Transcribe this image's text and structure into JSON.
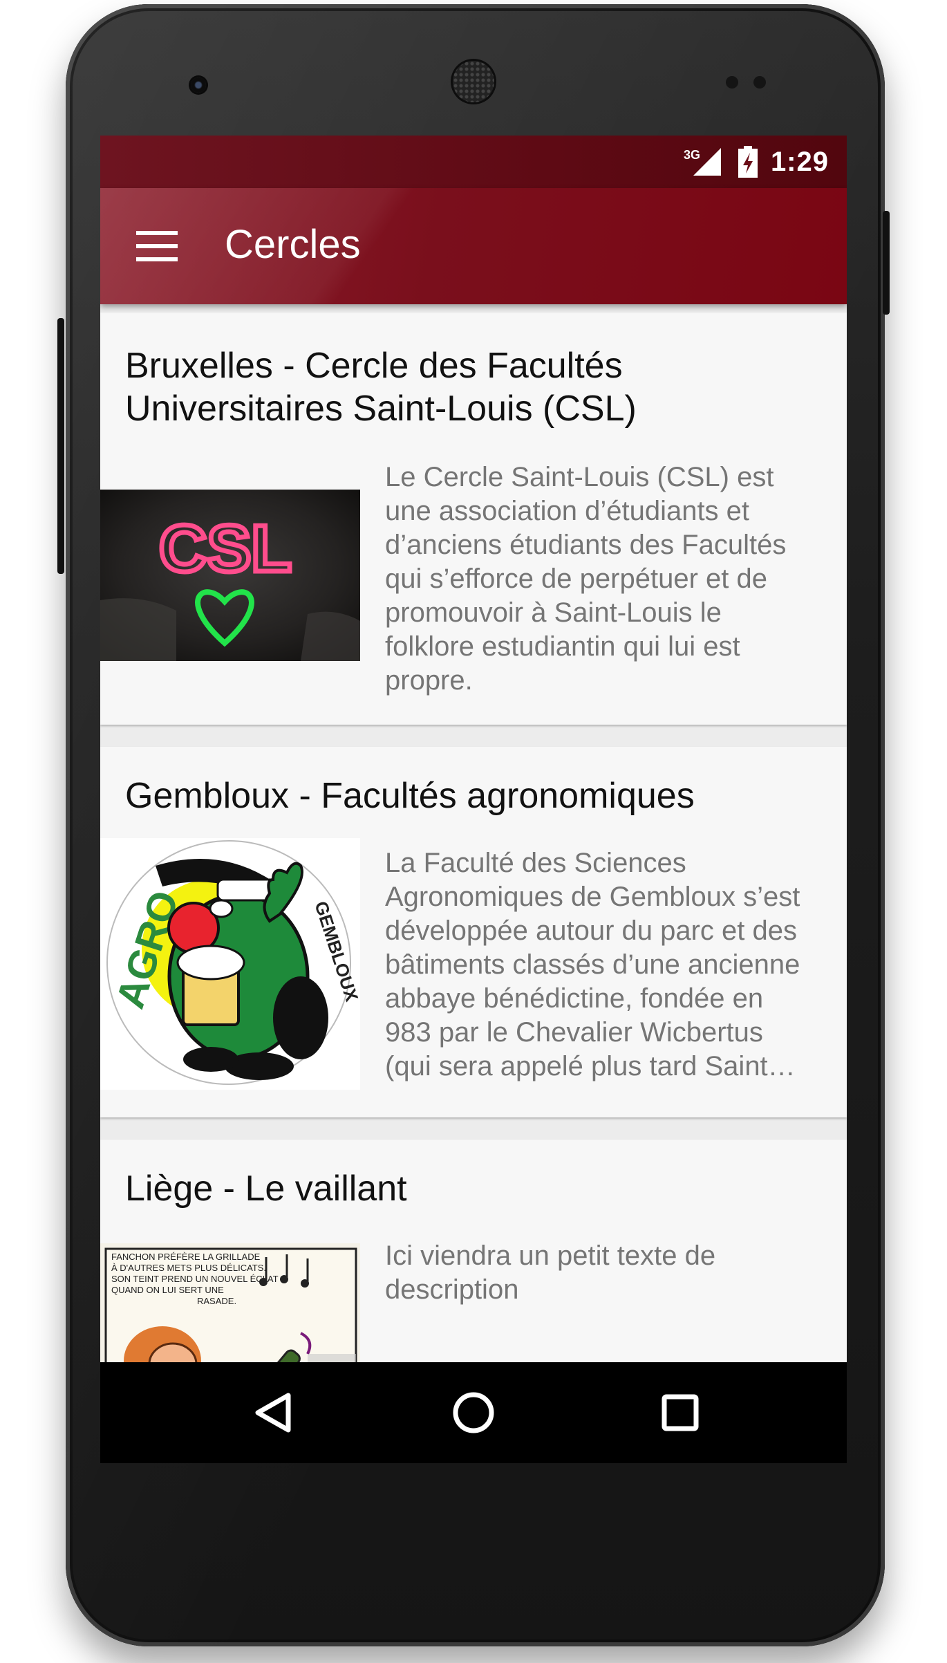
{
  "status_bar": {
    "network": "3G",
    "time": "1:29"
  },
  "toolbar": {
    "title": "Cercles",
    "menu_icon": "hamburger-menu-icon"
  },
  "cards": [
    {
      "title_line1": "Bruxelles - Cercle des Facultés",
      "title_line2": "Universitaires Saint-Louis (CSL)",
      "description": [
        "Le Cercle Saint-Louis (CSL) est",
        "une association d’étudiants et",
        "d’anciens étudiants des Facultés",
        "qui s’efforce de perpétuer et de",
        "promouvoir à Saint-Louis le",
        "folklore estudiantin qui lui est",
        "propre."
      ],
      "image_text": "CSL"
    },
    {
      "title_line1": "Gembloux - Facultés agronomiques",
      "description": [
        "La Faculté des Sciences",
        "Agronomiques de Gembloux s’est",
        "développée autour du parc et des",
        "bâtiments classés d’une ancienne",
        "abbaye bénédictine, fondée en",
        "983 par le Chevalier Wicbertus",
        "(qui sera appelé plus tard Saint…"
      ],
      "logo_left_text": "AGRO",
      "logo_right_text": "GEMBLOUX"
    },
    {
      "title_line1": "Liège - Le vaillant",
      "description": [
        "Ici viendra un petit texte de",
        "description"
      ],
      "comic_text": [
        "FANCHON PRÉFÈRE LA GRILLADE",
        "À D'AUTRES METS PLUS DÉLICATS.",
        "SON TEINT PREND UN NOUVEL ÉCLAT",
        "QUAND ON LUI SERT UNE",
        "RASADE."
      ]
    }
  ],
  "navigation_bar": {
    "back_icon": "back-triangle-icon",
    "home_icon": "home-circle-icon",
    "recents_icon": "recents-square-icon"
  },
  "colors": {
    "toolbar": "#7a0f1c",
    "status_bar": "#5e0a14",
    "card_background": "#f7f7f7",
    "description_text": "#757575"
  }
}
